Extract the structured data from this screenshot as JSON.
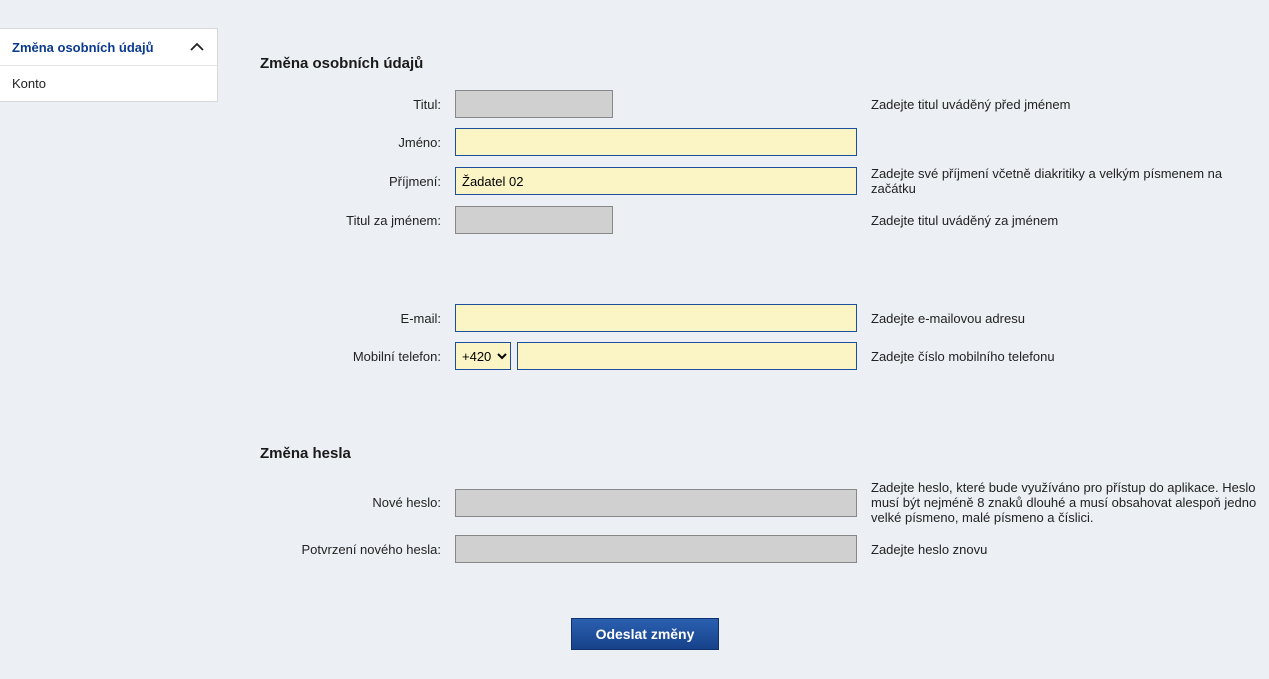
{
  "sidebar": {
    "items": [
      {
        "label": "Změna osobních údajů",
        "active": true
      },
      {
        "label": "Konto",
        "active": false
      }
    ]
  },
  "section1": {
    "title": "Změna osobních údajů",
    "fields": {
      "titul": {
        "label": "Titul:",
        "value": "",
        "hint": "Zadejte titul uváděný před jménem"
      },
      "jmeno": {
        "label": "Jméno:",
        "value": "",
        "hint": ""
      },
      "prijmeni": {
        "label": "Příjmení:",
        "value": "Žadatel 02",
        "hint": "Zadejte své příjmení včetně diakritiky a velkým písmenem na začátku"
      },
      "titulza": {
        "label": "Titul za jménem:",
        "value": "",
        "hint": "Zadejte titul uváděný za jménem"
      },
      "email": {
        "label": "E-mail:",
        "value": "",
        "hint": "Zadejte e-mailovou adresu"
      },
      "phone": {
        "label": "Mobilní telefon:",
        "prefix": "+420",
        "value": "",
        "hint": "Zadejte číslo mobilního telefonu"
      }
    }
  },
  "section2": {
    "title": "Změna hesla",
    "fields": {
      "newpass": {
        "label": "Nové heslo:",
        "value": "",
        "hint": "Zadejte heslo, které bude využíváno pro přístup do aplikace. Heslo musí být nejméně 8 znaků dlouhé a musí obsahovat alespoň jedno velké písmeno, malé písmeno a číslici."
      },
      "confirm": {
        "label": "Potvrzení nového hesla:",
        "value": "",
        "hint": "Zadejte heslo znovu"
      }
    }
  },
  "submit": {
    "label": "Odeslat změny"
  }
}
